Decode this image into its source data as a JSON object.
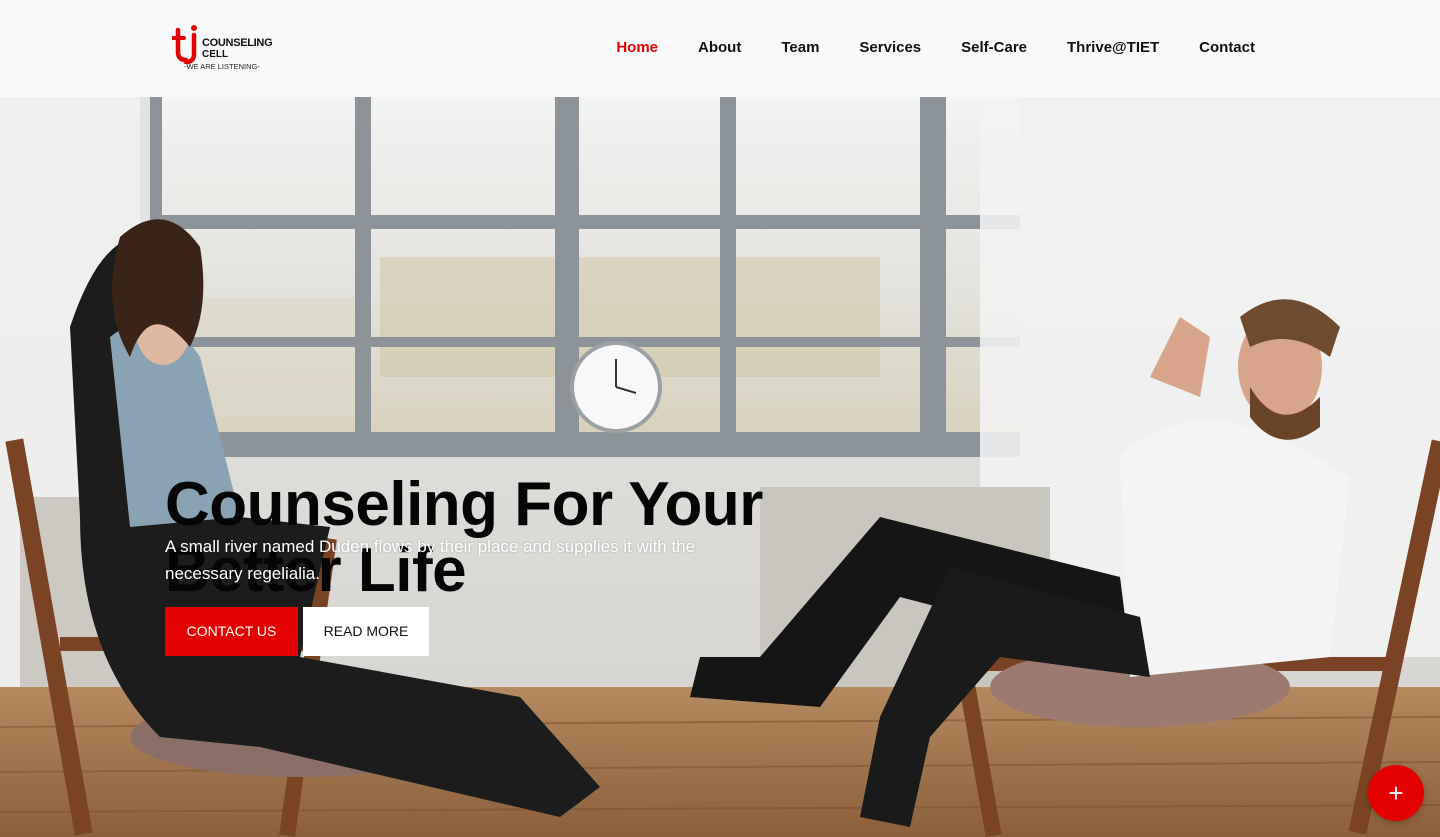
{
  "brand": {
    "logo_letters": "ti",
    "name_line1": "COUNSELING",
    "name_line2": "CELL",
    "tagline": "-WE ARE LISTENING-",
    "color": "#e40000"
  },
  "nav": {
    "items": [
      {
        "label": "Home",
        "active": true
      },
      {
        "label": "About"
      },
      {
        "label": "Team"
      },
      {
        "label": "Services"
      },
      {
        "label": "Self-Care"
      },
      {
        "label": "Thrive@TIET"
      },
      {
        "label": "Contact"
      }
    ]
  },
  "hero": {
    "title_line1": "Counseling For Your",
    "title_line2": "Better Life",
    "subtitle": "A small river named Duden flows by their place and supplies it with the necessary regelialia.",
    "primary_button": "CONTACT US",
    "secondary_button": "READ MORE"
  },
  "fab": {
    "icon": "plus-icon",
    "label": "+"
  }
}
